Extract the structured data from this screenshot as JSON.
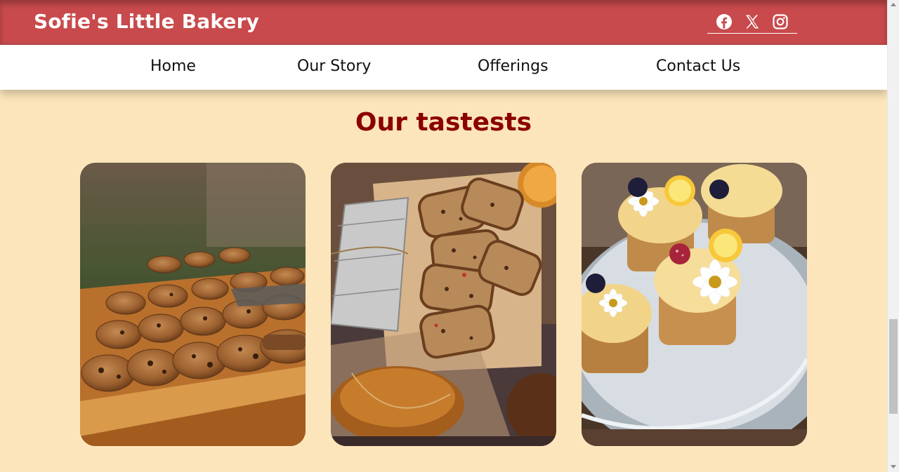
{
  "header": {
    "brand": "Sofie's Little Bakery",
    "bg_color": "#c84a4c",
    "social_icons": [
      "facebook-icon",
      "x-icon",
      "instagram-icon"
    ]
  },
  "nav": {
    "items": [
      {
        "label": "Home"
      },
      {
        "label": "Our Story"
      },
      {
        "label": "Offerings"
      },
      {
        "label": "Contact Us"
      }
    ]
  },
  "main": {
    "heading": "Our tastests",
    "heading_color": "#8b0000",
    "background_color": "#fce5bb",
    "gallery": [
      {
        "subject": "tray of chocolate chip cookies"
      },
      {
        "subject": "sliced fruit bread loaves"
      },
      {
        "subject": "lemon cupcakes with daisies and berries"
      }
    ]
  }
}
